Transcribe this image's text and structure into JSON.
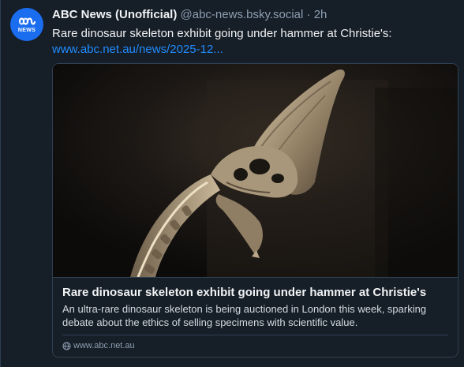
{
  "author": {
    "avatar_text": "NEWS",
    "display_name": "ABC News (Unofficial)",
    "handle": "@abc-news.bsky.social",
    "separator": "·",
    "time": "2h"
  },
  "post": {
    "text": "Rare dinosaur skeleton exhibit going under hammer at Christie's:",
    "link_text": "www.abc.net.au/news/2025-12..."
  },
  "card": {
    "image_subject": "dinosaur skull and neck skeleton on dark background",
    "title": "Rare dinosaur skeleton exhibit going under hammer at Christie's",
    "description": "An ultra-rare dinosaur skeleton is being auctioned in London this week, sparking debate about the ethics of selling specimens with scientific value.",
    "domain": "www.abc.net.au",
    "domain_icon": "globe-icon"
  },
  "colors": {
    "background": "#161e27",
    "border": "#2e4052",
    "link": "#208bfe",
    "muted": "#8d9eb2",
    "avatar": "#1b6df0"
  }
}
